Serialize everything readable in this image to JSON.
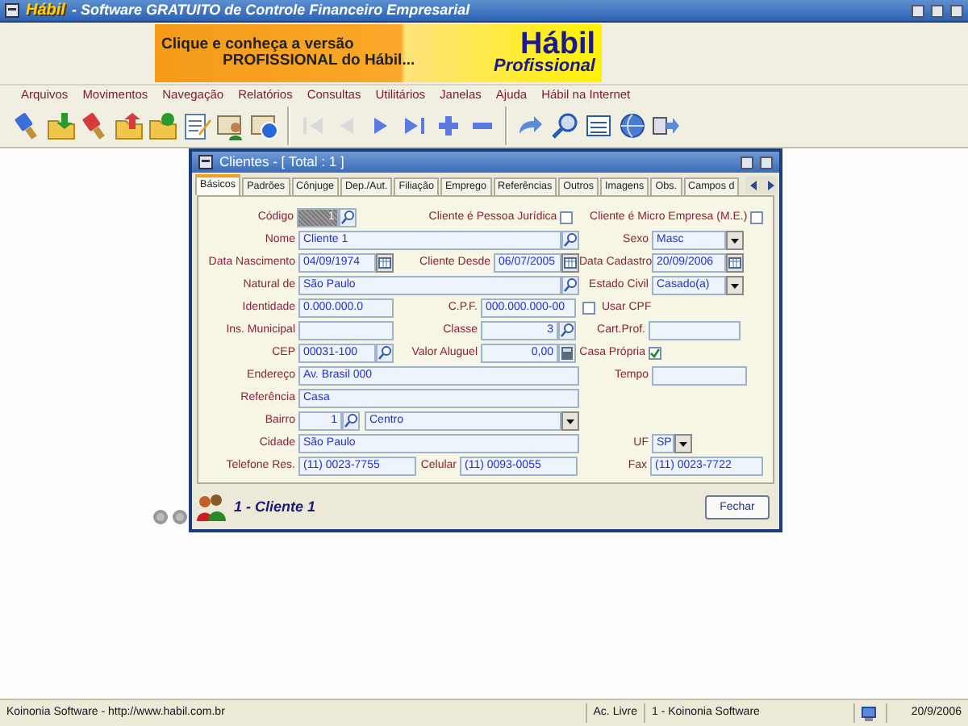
{
  "window": {
    "logo": "Hábil",
    "title": "- Software GRATUITO de Controle Financeiro Empresarial"
  },
  "banner": {
    "lines": [
      "Clique e conheça a versão",
      "PROFISSIONAL do Hábil..."
    ],
    "brand": "Hábil",
    "edition": "Profissional"
  },
  "menu": [
    "Arquivos",
    "Movimentos",
    "Navegação",
    "Relatórios",
    "Consultas",
    "Utilitários",
    "Janelas",
    "Ajuda",
    "Hábil na Internet"
  ],
  "toolbar": [
    {
      "kind": "brush",
      "disabled": false
    },
    {
      "kind": "folder-in",
      "disabled": false
    },
    {
      "kind": "brush-x",
      "disabled": false
    },
    {
      "kind": "folder-out",
      "disabled": false
    },
    {
      "kind": "folder-money",
      "disabled": false
    },
    {
      "kind": "edit",
      "disabled": false
    },
    {
      "kind": "person-card",
      "disabled": false
    },
    {
      "kind": "card-globe",
      "disabled": false
    },
    {
      "kind": "sep"
    },
    {
      "kind": "first",
      "disabled": true
    },
    {
      "kind": "prev",
      "disabled": true
    },
    {
      "kind": "next",
      "disabled": false
    },
    {
      "kind": "last",
      "disabled": false
    },
    {
      "kind": "add",
      "disabled": false
    },
    {
      "kind": "remove",
      "disabled": false
    },
    {
      "kind": "sep"
    },
    {
      "kind": "redo",
      "disabled": false
    },
    {
      "kind": "search",
      "disabled": false
    },
    {
      "kind": "list",
      "disabled": false
    },
    {
      "kind": "globe",
      "disabled": false
    },
    {
      "kind": "export",
      "disabled": false
    }
  ],
  "dialog": {
    "title": "Clientes - [ Total : 1 ]",
    "tabs": [
      {
        "label": "Básicos",
        "selected": true
      },
      {
        "label": "Padrões",
        "selected": false
      },
      {
        "label": "Cônjuge",
        "selected": false
      },
      {
        "label": "Dep./Aut.",
        "selected": false
      },
      {
        "label": "Filiação",
        "selected": false
      },
      {
        "label": "Emprego",
        "selected": false
      },
      {
        "label": "Referências",
        "selected": false
      },
      {
        "label": "Outros",
        "selected": false
      },
      {
        "label": "Imagens",
        "selected": false
      },
      {
        "label": "Obs.",
        "selected": false
      },
      {
        "label": "Campos d",
        "selected": false
      }
    ],
    "rows": [
      [
        {
          "kind": "locked",
          "label": "Código",
          "value": "1"
        },
        {
          "kind": "check",
          "label": "Cliente é Pessoa Jurídica",
          "checked": false
        },
        {
          "kind": "check",
          "label": "Cliente é Micro Empresa (M.E.)",
          "checked": false
        }
      ],
      [
        {
          "kind": "lookup",
          "label": "Nome",
          "value": "Cliente 1"
        },
        {
          "kind": "select",
          "label": "Sexo",
          "value": "Masc"
        }
      ],
      [
        {
          "kind": "date",
          "label": "Data Nascimento",
          "value": "04/09/1974"
        },
        {
          "kind": "date",
          "label": "Cliente Desde",
          "value": "06/07/2005"
        },
        {
          "kind": "date",
          "label": "Data Cadastro",
          "value": "20/09/2006"
        }
      ],
      [
        {
          "kind": "lookup",
          "label": "Natural de",
          "value": "São Paulo"
        },
        {
          "kind": "select",
          "label": "Estado Civil",
          "value": "Casado(a)"
        }
      ],
      [
        {
          "kind": "text",
          "label": "Identidade",
          "value": "0.000.000.0"
        },
        {
          "kind": "text",
          "label": "C.P.F.",
          "value": "000.000.000-00"
        },
        {
          "kind": "checkafter",
          "label": "Usar CPF",
          "checked": false
        }
      ],
      [
        {
          "kind": "text",
          "label": "Ins. Municipal"
        },
        {
          "kind": "numlookup",
          "label": "Classe",
          "value": "3"
        },
        {
          "kind": "text",
          "label": "Cart.Prof."
        }
      ],
      [
        {
          "kind": "lookup",
          "label": "CEP",
          "value": "00031-100"
        },
        {
          "kind": "money",
          "label": "Valor Aluguel",
          "value": "0,00"
        },
        {
          "kind": "check",
          "label": "Casa Própria",
          "checked": true
        }
      ],
      [
        {
          "kind": "text",
          "label": "Endereço",
          "value": "Av. Brasil 000"
        },
        {
          "kind": "text",
          "label": "Tempo"
        }
      ],
      [
        {
          "kind": "text",
          "label": "Referência",
          "value": "Casa"
        }
      ],
      [
        {
          "kind": "numlookup",
          "label": "Bairro",
          "value": "1"
        },
        {
          "kind": "select",
          "value": "Centro"
        }
      ],
      [
        {
          "kind": "text",
          "label": "Cidade",
          "value": "São Paulo"
        },
        {
          "kind": "select",
          "label": "UF",
          "value": "SP"
        }
      ],
      [
        {
          "kind": "text",
          "label": "Telefone Res.",
          "value": "(11) 0023-7755"
        },
        {
          "kind": "text",
          "label": "Celular",
          "value": "(11) 0093-0055"
        },
        {
          "kind": "text",
          "label": "Fax",
          "value": "(11) 0023-7722"
        }
      ]
    ],
    "footer": {
      "record": "1 - Cliente 1",
      "button": "Fechar"
    }
  },
  "status_bar": [
    "Koinonia Software  - http://www.habil.com.br",
    "Ac. Livre",
    "1 - Koinonia Software",
    "20/9/2006"
  ]
}
